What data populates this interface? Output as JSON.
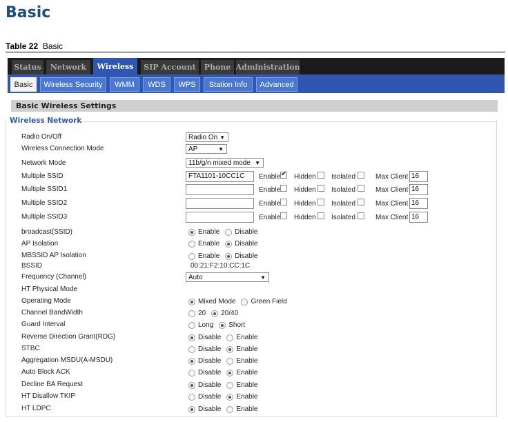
{
  "document": {
    "heading": "Basic",
    "caption_prefix": "Table 22",
    "caption_text": "Basic"
  },
  "top_tabs": [
    "Status",
    "Network",
    "Wireless",
    "SIP Account",
    "Phone",
    "Administration"
  ],
  "sub_tabs": [
    "Basic",
    "Wireless Security",
    "WMM",
    "WDS",
    "WPS",
    "Station Info",
    "Advanced"
  ],
  "section": {
    "title": "Basic Wireless Settings",
    "legend": "Wireless Network"
  },
  "labels": {
    "radio": "Radio On/Off",
    "conn_mode": "Wireless Connection Mode",
    "net_mode": "Network Mode",
    "ssid0": "Multiple SSID",
    "ssid1": "Multiple SSID1",
    "ssid2": "Multiple SSID2",
    "ssid3": "Multiple SSID3",
    "broadcast": "broadcast(SSID)",
    "ap_iso": "AP Isolation",
    "mbssid_iso": "MBSSID AP Isolation",
    "bssid": "BSSID",
    "freq": "Frequency (Channel)",
    "ht_phy": "HT Physical Mode",
    "op_mode": "Operating Mode",
    "bandwidth": "Channel BandWidth",
    "guard": "Guard Interval",
    "rdg": "Reverse Direction Grant(RDG)",
    "stbc": "STBC",
    "amsdu": "Aggregation MSDU(A-MSDU)",
    "autoba": "Auto Block ACK",
    "declineba": "Decline BA Request",
    "tkip": "HT Disallow TKIP",
    "ldpc": "HT LDPC"
  },
  "selects": {
    "radio": "Radio On",
    "conn_mode": "AP",
    "net_mode": "11b/g/n mixed mode",
    "freq": "Auto"
  },
  "ssid_rows": [
    {
      "value": "FTA1101-10CC1C",
      "enable": true,
      "hidden": false,
      "isolated": false,
      "max_client": "16"
    },
    {
      "value": "",
      "enable": false,
      "hidden": false,
      "isolated": false,
      "max_client": "16"
    },
    {
      "value": "",
      "enable": false,
      "hidden": false,
      "isolated": false,
      "max_client": "16"
    },
    {
      "value": "",
      "enable": false,
      "hidden": false,
      "isolated": false,
      "max_client": "16"
    }
  ],
  "ssid_option_labels": {
    "enable": "Enable",
    "hidden": "Hidden",
    "isolated": "Isolated",
    "max_client": "Max Client"
  },
  "bssid_value": "00:21:F2:10:CC:1C",
  "option_labels": {
    "enable": "Enable",
    "disable": "Disable",
    "mixed": "Mixed Mode",
    "green": "Green Field",
    "bw20": "20",
    "bw40": "20/40",
    "long": "Long",
    "short": "Short"
  }
}
